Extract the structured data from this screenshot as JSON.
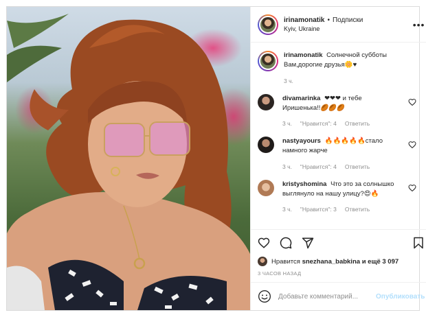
{
  "header": {
    "username": "irinamonatik",
    "separator": "•",
    "follow_label": "Подписки",
    "location": "Kyiv, Ukraine"
  },
  "caption": {
    "username": "irinamonatik",
    "text": "Солнечной субботы Вам,дорогие друзья🌼♥",
    "time": "3 ч."
  },
  "comments": [
    {
      "username": "divamarinka",
      "text": "❤❤❤ и тебе Иришенька!!🏉🏉🏉",
      "time": "3 ч.",
      "likes": "\"Нравится\": 4",
      "reply": "Ответить",
      "avatar_color": "#3a3a3a"
    },
    {
      "username": "nastyayours",
      "text": "🔥🔥🔥🔥🔥стало намного жарче",
      "time": "3 ч.",
      "likes": "\"Нравится\": 4",
      "reply": "Ответить",
      "avatar_color": "#2e2a28"
    },
    {
      "username": "kristyshomina",
      "text": "Что это за солнышко выглянуло на нашу улицу?😍🔥",
      "time": "3 ч.",
      "likes": "\"Нравится\": 3",
      "reply": "Ответить",
      "avatar_color": "#c9a07e"
    }
  ],
  "likes": {
    "prefix": "Нравится",
    "user": "snezhana_babkina",
    "suffix": "и ещё 3 097"
  },
  "date": "3 ЧАСОВ НАЗАД",
  "add_comment": {
    "placeholder": "Добавьте комментарий...",
    "post_label": "Опубликовать"
  },
  "icons": {
    "like": "heart-icon",
    "comment": "comment-icon",
    "share": "send-icon",
    "save": "bookmark-icon",
    "more": "more-icon",
    "emoji": "emoji-icon"
  },
  "colors": {
    "accent": "#0095f6",
    "post_disabled": "#b2dffc",
    "muted": "#8e8e8e"
  }
}
